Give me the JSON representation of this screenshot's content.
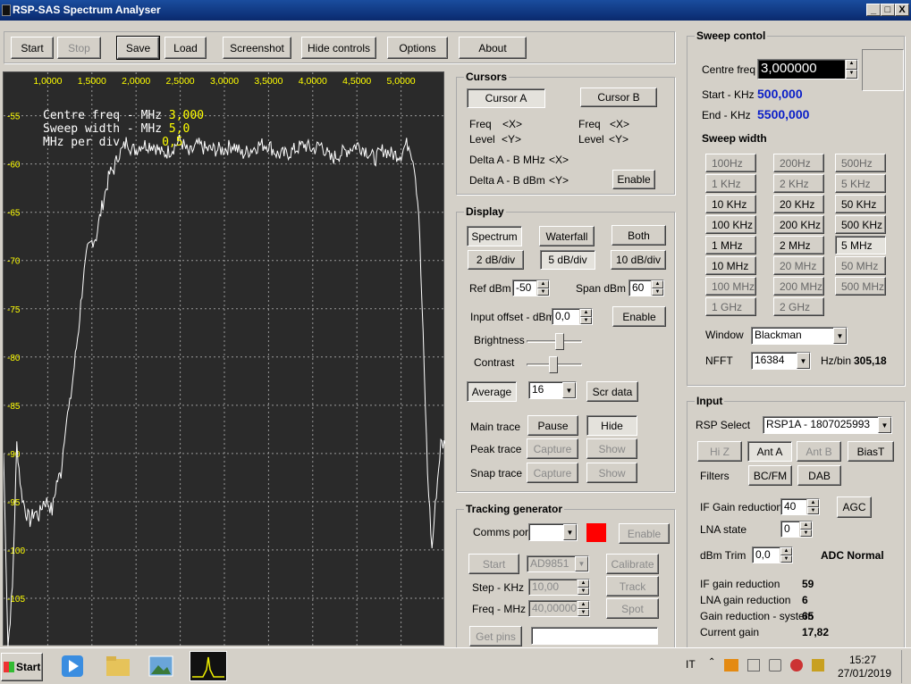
{
  "window": {
    "title": "RSP-SAS Spectrum Analyser",
    "buttons": [
      "_",
      "□",
      "X"
    ]
  },
  "toolbar": {
    "start": "Start",
    "stop": "Stop",
    "save": "Save",
    "load": "Load",
    "screenshot": "Screenshot",
    "hide_controls": "Hide controls",
    "options": "Options",
    "about": "About"
  },
  "plot": {
    "x_ticks": [
      "1,0000",
      "1,5000",
      "2,0000",
      "2,5000",
      "3,0000",
      "3,5000",
      "4,0000",
      "4,5000",
      "5,0000"
    ],
    "y_ticks": [
      "-55",
      "-60",
      "-65",
      "-70",
      "-75",
      "-80",
      "-85",
      "-90",
      "-95",
      "-100",
      "-105"
    ],
    "info": [
      {
        "label": "Centre freq - MHz",
        "value": "3,000"
      },
      {
        "label": "Sweep width - MHz",
        "value": "5,0"
      },
      {
        "label": "MHz per div",
        "value": "0,5"
      }
    ],
    "trace_color": "#ffffff",
    "grid_color": "#9a9a9a",
    "tick_color": "#ffff00"
  },
  "chart_data": {
    "type": "line",
    "title": "",
    "xlabel": "",
    "ylabel": "",
    "xlim": [
      0.5,
      5.5
    ],
    "ylim": [
      -110,
      -50.5
    ],
    "grid": true,
    "series": [
      {
        "x": [
          0.5,
          0.55,
          0.6,
          0.65,
          0.7,
          0.75,
          0.8,
          0.85,
          0.9,
          0.95,
          1.0,
          1.05,
          1.1,
          1.15,
          1.2,
          1.25,
          1.3,
          1.35,
          1.4,
          1.45,
          1.5,
          1.55,
          1.6,
          1.65,
          1.7,
          1.75,
          1.8,
          1.85,
          1.9,
          1.95,
          2.0,
          2.05,
          2.1,
          2.2,
          2.3,
          2.4,
          2.5,
          2.6,
          2.7,
          2.8,
          2.9,
          3.0,
          3.1,
          3.2,
          3.3,
          3.4,
          3.5,
          3.6,
          3.7,
          3.8,
          3.9,
          4.0,
          4.1,
          4.2,
          4.3,
          4.4,
          4.5,
          4.6,
          4.7,
          4.8,
          4.9,
          5.0,
          5.05,
          5.1,
          5.12,
          5.15,
          5.2,
          5.25,
          5.3,
          5.35,
          5.4,
          5.45,
          5.5
        ],
        "y": [
          -90,
          -110,
          -104,
          -89,
          -94,
          -96,
          -97,
          -96,
          -96.5,
          -95,
          -95,
          -96,
          -93,
          -92,
          -87,
          -85,
          -81,
          -77,
          -72,
          -69,
          -68,
          -67.5,
          -65,
          -63,
          -61,
          -60.5,
          -59,
          -58.5,
          -57.5,
          -58.5,
          -58.5,
          -58,
          -58,
          -58,
          -59,
          -58.5,
          -57.5,
          -59,
          -58,
          -58.5,
          -58.5,
          -58.5,
          -58,
          -59,
          -58.5,
          -58,
          -58,
          -59,
          -59,
          -58.5,
          -58,
          -58.5,
          -58,
          -59.5,
          -59,
          -58.5,
          -58,
          -58.5,
          -59.5,
          -58.5,
          -59,
          -59,
          -58,
          -58,
          -59,
          -60,
          -65,
          -78,
          -92,
          -100,
          -94,
          -89,
          -89
        ]
      }
    ]
  },
  "cursors": {
    "title": "Cursors",
    "cursor_a": "Cursor A",
    "cursor_b": "Cursor B",
    "freq_label": "Freq",
    "freq_val": "<X>",
    "level_label": "Level",
    "level_val": "<Y>",
    "delta_mhz_label": "Delta A - B MHz",
    "delta_mhz_val": "<X>",
    "delta_dbm_label": "Delta A - B dBm",
    "delta_dbm_val": "<Y>",
    "enable": "Enable"
  },
  "display": {
    "title": "Display",
    "spectrum": "Spectrum",
    "waterfall": "Waterfall",
    "both": "Both",
    "db2": "2 dB/div",
    "db5": "5 dB/div",
    "db10": "10 dB/div",
    "ref_dbm_label": "Ref dBm",
    "ref_dbm": "-50",
    "span_dbm_label": "Span dBm",
    "span_dbm": "60",
    "input_offset_label": "Input offset - dBm",
    "input_offset": "0,0",
    "enable": "Enable",
    "brightness": "Brightness",
    "brightness_level": 0.62,
    "contrast": "Contrast",
    "contrast_level": 0.48,
    "average": "Average",
    "average_value": "16",
    "scr_data": "Scr data",
    "main_trace": "Main trace",
    "pause": "Pause",
    "hide": "Hide",
    "peak_trace": "Peak trace",
    "snap_trace": "Snap trace",
    "capture": "Capture",
    "show": "Show"
  },
  "tracking": {
    "title": "Tracking generator",
    "comms_port": "Comms port",
    "comms_value": "",
    "enable": "Enable",
    "start": "Start",
    "device": "AD9851",
    "calibrate": "Calibrate",
    "step_label": "Step - KHz",
    "step_value": "10,00",
    "track": "Track",
    "freq_label": "Freq - MHz",
    "freq_value": "40,000000",
    "spot": "Spot",
    "get_pins": "Get pins",
    "pins_value": "",
    "indicator_color": "#ff0000"
  },
  "sweep": {
    "title": "Sweep contol",
    "centre_label": "Centre freq",
    "centre_value": "3,000000",
    "start_label": "Start - KHz",
    "start_value": "500,000",
    "end_label": "End - KHz",
    "end_value": "5500,000",
    "width_title": "Sweep width",
    "widths": [
      "100Hz",
      "200Hz",
      "500Hz",
      "1 KHz",
      "2 KHz",
      "5 KHz",
      "10 KHz",
      "20 KHz",
      "50 KHz",
      "100 KHz",
      "200 KHz",
      "500 KHz",
      "1 MHz",
      "2 MHz",
      "5 MHz",
      "10 MHz",
      "20 MHz",
      "50 MHz",
      "100 MHz",
      "200 MHz",
      "500 MHz",
      "1 GHz",
      "2 GHz"
    ],
    "window_label": "Window",
    "window_value": "Blackman",
    "nfft_label": "NFFT",
    "nfft_value": "16384",
    "hzbin_label": "Hz/bin",
    "hzbin_value": "305,18"
  },
  "input": {
    "title": "Input",
    "rsp_select_label": "RSP Select",
    "rsp_select_value": "RSP1A - 1807025993",
    "hiz": "Hi Z",
    "ant_a": "Ant A",
    "ant_b": "Ant B",
    "biast": "BiasT",
    "filters_label": "Filters",
    "bcfm": "BC/FM",
    "dab": "DAB",
    "if_gain_label": "IF Gain reduction",
    "if_gain_value": "40",
    "agc": "AGC",
    "lna_label": "LNA state",
    "lna_value": "0",
    "dbm_trim_label": "dBm Trim",
    "dbm_trim_value": "0,0",
    "adc_status": "ADC Normal",
    "stats": [
      {
        "label": "IF gain reduction",
        "value": "59"
      },
      {
        "label": "LNA gain reduction",
        "value": "6"
      },
      {
        "label": "Gain reduction - system",
        "value": "65"
      },
      {
        "label": "Current gain",
        "value": "17,82"
      }
    ]
  },
  "taskbar": {
    "start": "Start",
    "lang": "IT",
    "time": "15:27",
    "date": "27/01/2019"
  }
}
